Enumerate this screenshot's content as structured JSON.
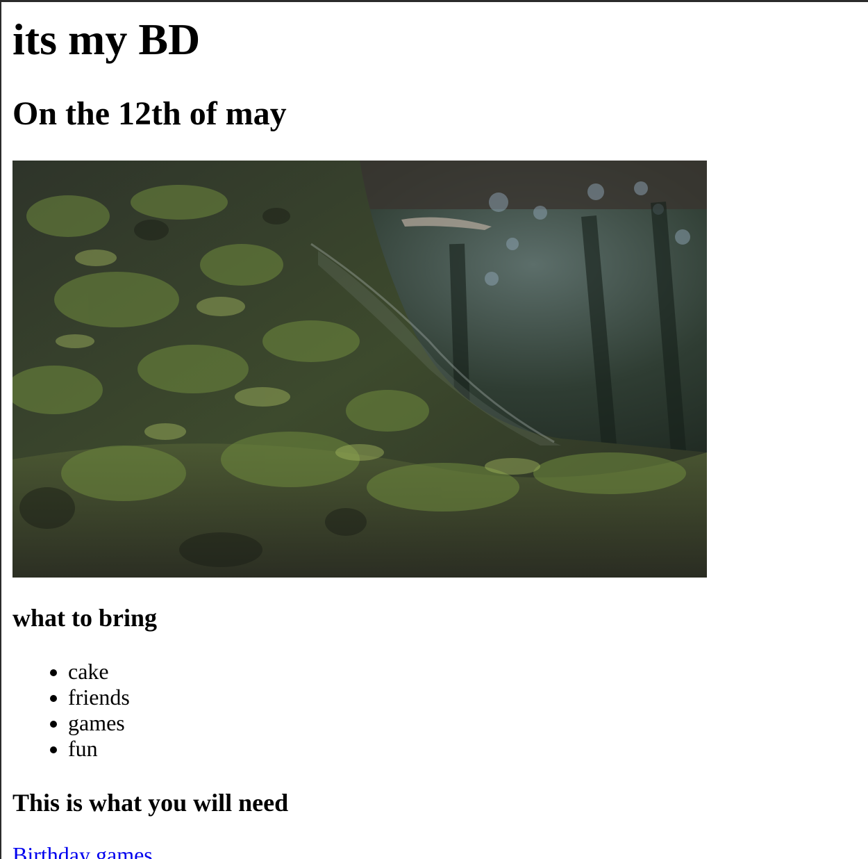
{
  "page": {
    "title": "its my BD",
    "date_heading": "On the 12th of may",
    "photo_subject": "mossy-tree-trunk-photo"
  },
  "bring": {
    "heading": "what to bring",
    "items": [
      {
        "label": "cake"
      },
      {
        "label": "friends"
      },
      {
        "label": "games"
      },
      {
        "label": "fun"
      }
    ]
  },
  "need": {
    "heading": "This is what you will need",
    "link_label": "Birthday games"
  },
  "colors": {
    "link": "#0000ee",
    "text": "#000000",
    "background": "#ffffff",
    "frame": "#2b2b2b"
  }
}
